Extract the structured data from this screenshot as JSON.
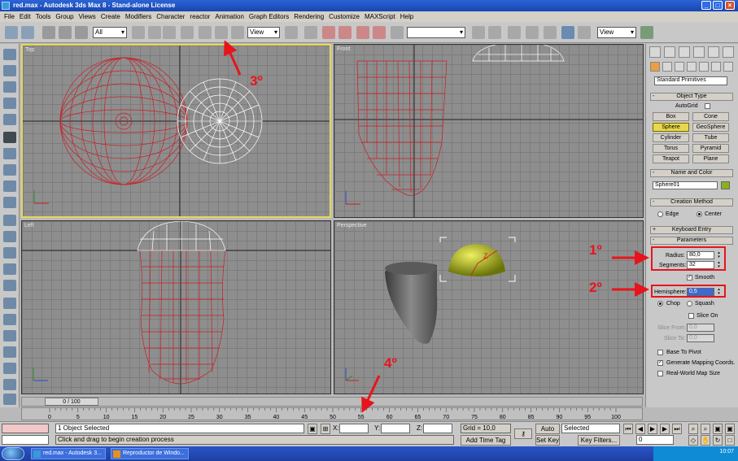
{
  "window": {
    "title": "red.max - Autodesk 3ds Max 8 - Stand-alone License"
  },
  "menu": [
    "File",
    "Edit",
    "Tools",
    "Group",
    "Views",
    "Create",
    "Modifiers",
    "Character",
    "reactor",
    "Animation",
    "Graph Editors",
    "Rendering",
    "Customize",
    "MAXScript",
    "Help"
  ],
  "toolbar": {
    "selection_filter": "All",
    "ref_coord": "View",
    "named_selection": "",
    "render_view": "View"
  },
  "viewports": {
    "top": "Top",
    "front": "Front",
    "left": "Left",
    "perspective": "Perspective"
  },
  "time": {
    "slider": "0 / 100",
    "ticks": [
      "0",
      "5",
      "10",
      "15",
      "20",
      "25",
      "30",
      "35",
      "40",
      "45",
      "50",
      "55",
      "60",
      "65",
      "70",
      "75",
      "80",
      "85",
      "90",
      "95",
      "100"
    ]
  },
  "status": {
    "selected": "1 Object Selected",
    "prompt": "Click and drag to begin creation process",
    "x_label": "X:",
    "y_label": "Y:",
    "z_label": "Z:",
    "grid": "Grid = 10,0",
    "add_time_tag": "Add Time Tag",
    "auto_key": "Auto Key",
    "set_key": "Set Key",
    "key_mode": "Selected",
    "key_filters": "Key Filters...",
    "frame": "0"
  },
  "panel": {
    "category": "Standard Primitives",
    "object_type": {
      "title": "Object Type",
      "autogrid": "AutoGrid",
      "buttons": [
        "Box",
        "Cone",
        "Sphere",
        "GeoSphere",
        "Cylinder",
        "Tube",
        "Torus",
        "Pyramid",
        "Teapot",
        "Plane"
      ],
      "active": "Sphere"
    },
    "name_color": {
      "title": "Name and Color",
      "name": "Sphere01",
      "color": "#8ab01e"
    },
    "creation": {
      "title": "Creation Method",
      "edge": "Edge",
      "center": "Center"
    },
    "keyboard": {
      "title": "Keyboard Entry"
    },
    "params": {
      "title": "Parameters",
      "radius_label": "Radius:",
      "radius": "80,0",
      "segments_label": "Segments:",
      "segments": "32",
      "smooth": "Smooth",
      "hemisphere_label": "Hemisphere:",
      "hemisphere": "0,5",
      "chop": "Chop",
      "squash": "Squash",
      "slice_on": "Slice On",
      "slice_from_label": "Slice From:",
      "slice_from": "0,0",
      "slice_to_label": "Slice To:",
      "slice_to": "0,0",
      "base_to_pivot": "Base To Pivot",
      "mapping": "Generate Mapping Coords.",
      "real_world": "Real-World Map Size"
    }
  },
  "annotations": {
    "a1": "1º",
    "a2": "2º",
    "a3": "3º",
    "a4": "4º"
  },
  "taskbar": {
    "tasks": [
      "red.max - Autodesk 3...",
      "Reproductor de Windo..."
    ],
    "clock": "10:07"
  },
  "colors": {
    "accent": "#e8141c",
    "wire_red": "#c81f25",
    "wire_white": "#ffffff",
    "sphere_yellow": "#bcc814",
    "viewport_bg": "#8e8e8e"
  }
}
